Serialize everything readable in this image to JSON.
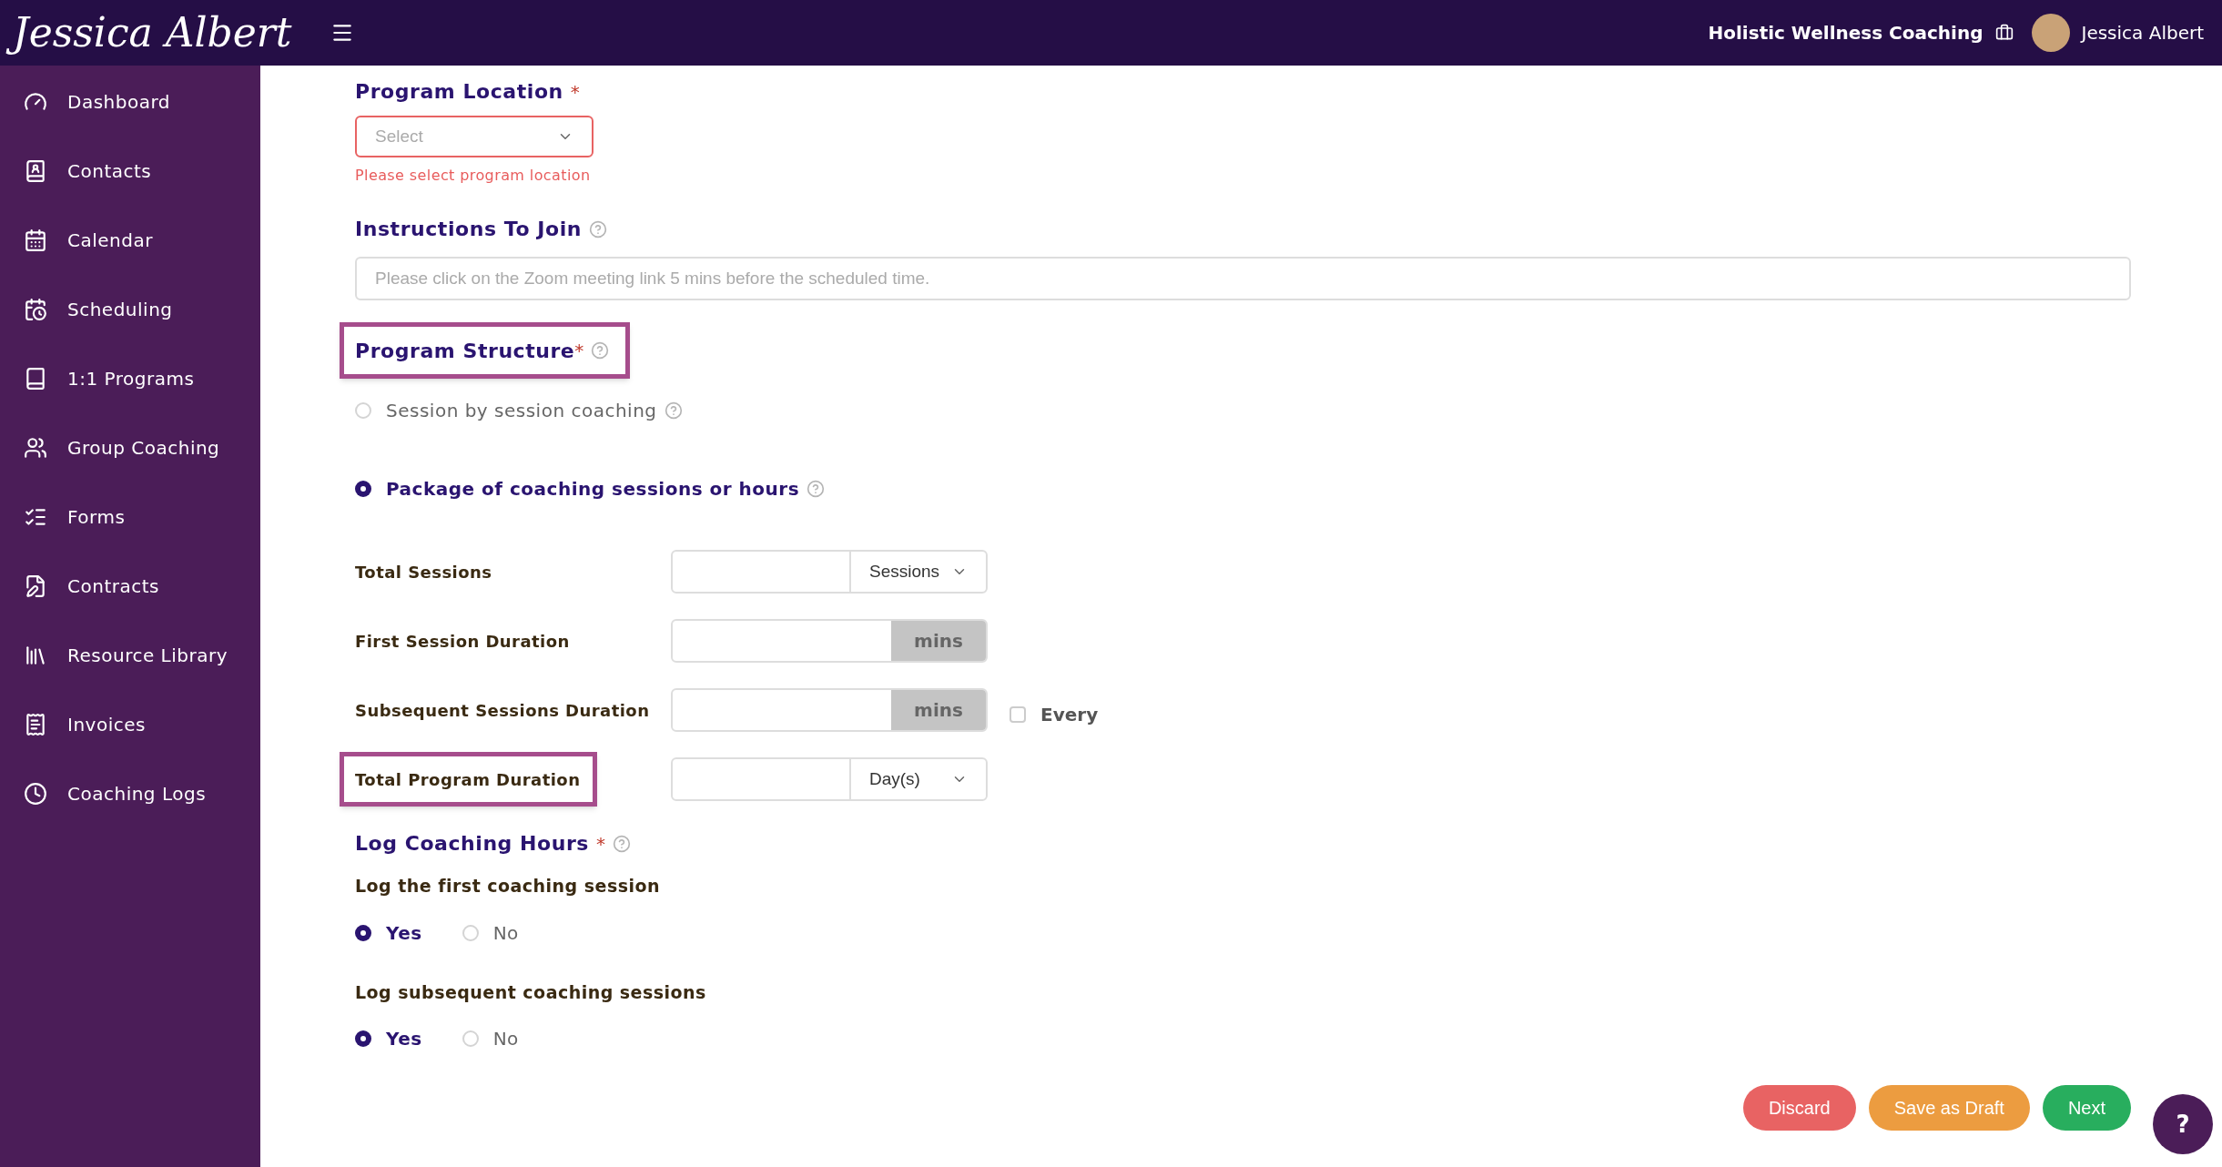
{
  "header": {
    "logo": "Jessica Albert",
    "business": "Holistic Wellness Coaching",
    "user": "Jessica Albert"
  },
  "sidebar": {
    "items": [
      {
        "label": "Dashboard",
        "kind": "dashboard"
      },
      {
        "label": "Contacts",
        "kind": "contacts"
      },
      {
        "label": "Calendar",
        "kind": "calendar"
      },
      {
        "label": "Scheduling",
        "kind": "scheduling"
      },
      {
        "label": "1:1 Programs",
        "kind": "programs"
      },
      {
        "label": "Group Coaching",
        "kind": "group"
      },
      {
        "label": "Forms",
        "kind": "forms"
      },
      {
        "label": "Contracts",
        "kind": "contracts"
      },
      {
        "label": "Resource Library",
        "kind": "library"
      },
      {
        "label": "Invoices",
        "kind": "invoices"
      },
      {
        "label": "Coaching Logs",
        "kind": "logs"
      }
    ]
  },
  "form": {
    "program_location": {
      "label": "Program Location",
      "required_mark": "*",
      "placeholder": "Select",
      "error": "Please select program location"
    },
    "instructions": {
      "label": "Instructions To Join",
      "placeholder": "Please click on the Zoom meeting link 5 mins before the scheduled time."
    },
    "program_structure": {
      "label": "Program Structure",
      "required_mark": "*",
      "highlighted": true,
      "options": [
        {
          "label": "Session by session coaching",
          "selected": false
        },
        {
          "label": "Package of coaching sessions or hours",
          "selected": true
        }
      ]
    },
    "fields": [
      {
        "label": "Total Sessions",
        "kind": "select",
        "unit": "Sessions",
        "highlighted": false
      },
      {
        "label": "First Session Duration",
        "kind": "addon",
        "unit": "mins",
        "highlighted": false
      },
      {
        "label": "Subsequent Sessions Duration",
        "kind": "addon",
        "unit": "mins",
        "highlighted": false,
        "checkbox": {
          "label": "Every",
          "checked": false
        }
      },
      {
        "label": "Total Program Duration",
        "kind": "select",
        "unit": "Day(s)",
        "highlighted": true
      }
    ],
    "log_hours": {
      "label": "Log Coaching Hours",
      "required_mark": "*",
      "questions": [
        {
          "label": "Log the first coaching session",
          "options": [
            {
              "label": "Yes",
              "selected": true
            },
            {
              "label": "No",
              "selected": false
            }
          ]
        },
        {
          "label": "Log subsequent coaching sessions",
          "options": [
            {
              "label": "Yes",
              "selected": true
            },
            {
              "label": "No",
              "selected": false
            }
          ]
        }
      ]
    }
  },
  "actions": [
    {
      "label": "Discard",
      "kind": "discard"
    },
    {
      "label": "Save as Draft",
      "kind": "draft"
    },
    {
      "label": "Next",
      "kind": "next"
    }
  ],
  "help_button": "?"
}
